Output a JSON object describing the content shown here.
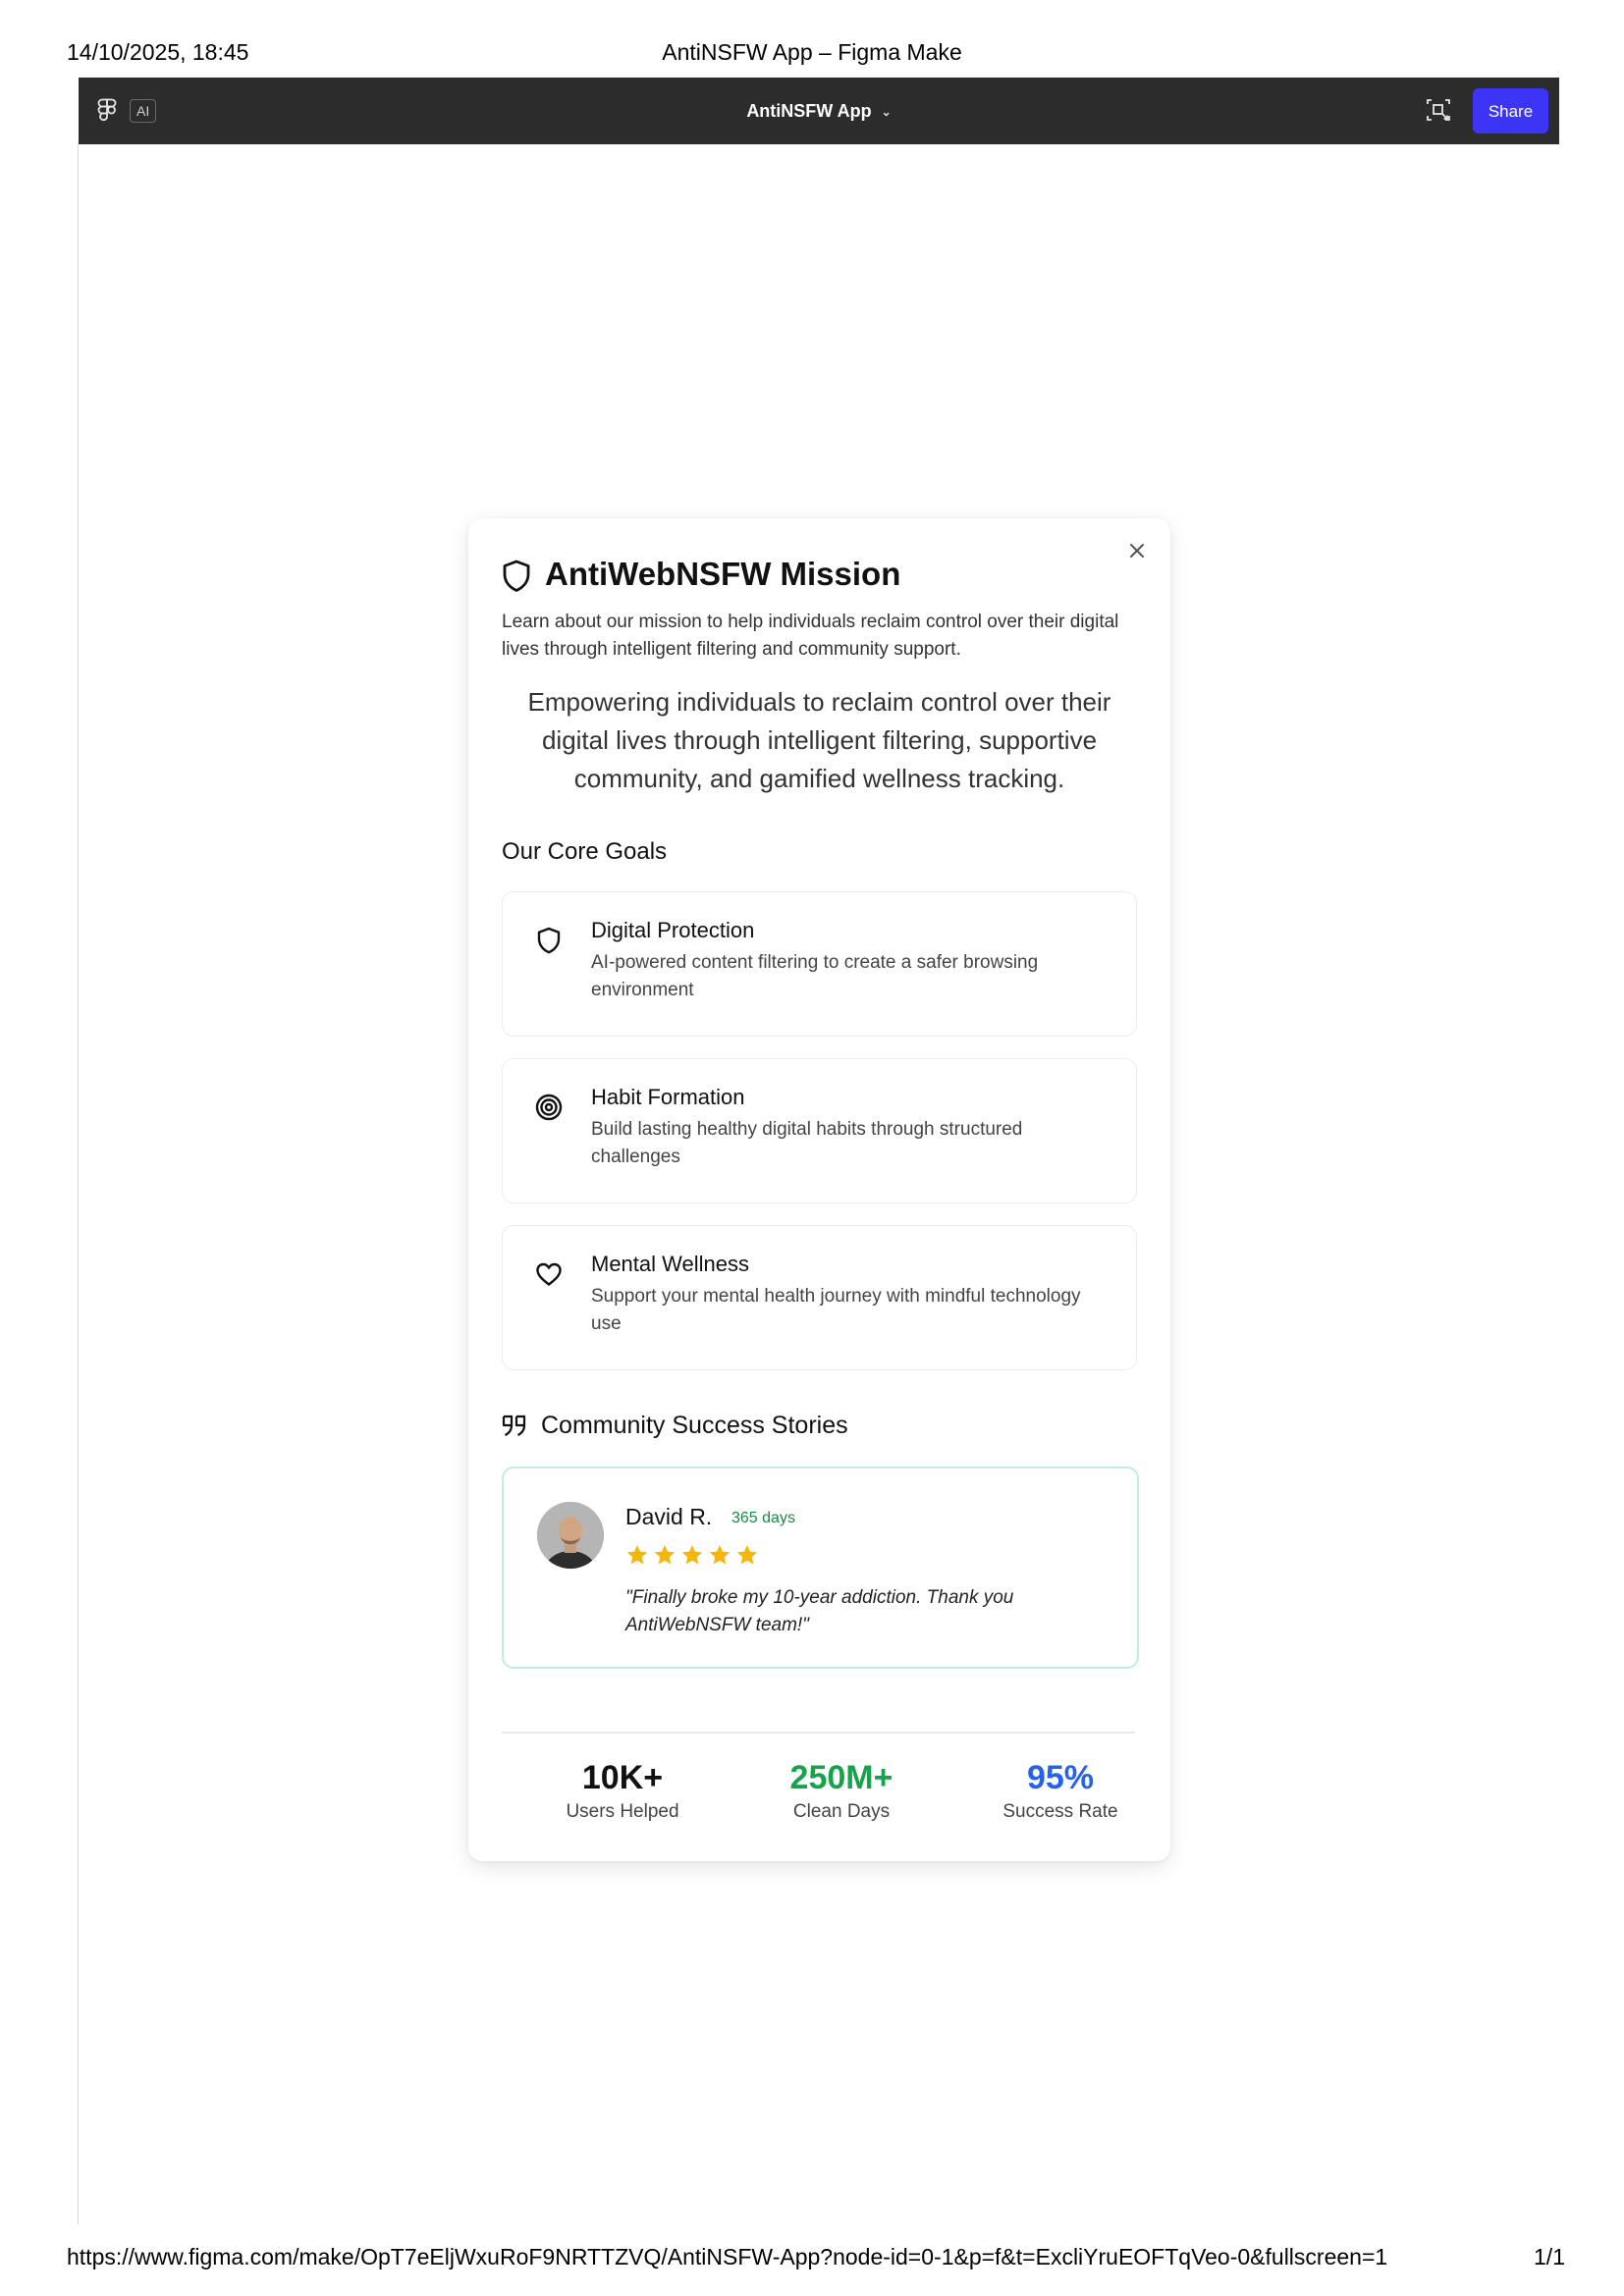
{
  "print": {
    "datetime": "14/10/2025, 18:45",
    "title": "AntiNSFW App – Figma Make",
    "url": "https://www.figma.com/make/OpT7eEljWxuRoF9NRTTZVQ/AntiNSFW-App?node-id=0-1&p=f&t=ExcliYruEOFTqVeo-0&fullscreen=1",
    "page": "1/1"
  },
  "topbar": {
    "ai_badge": "AI",
    "app_title": "AntiNSFW App",
    "share_label": "Share",
    "colors": {
      "bar": "#2c2c2c",
      "share": "#3d35f5"
    }
  },
  "modal": {
    "title": "AntiWebNSFW Mission",
    "description": "Learn about our mission to help individuals reclaim control over their digital lives through intelligent filtering and community support.",
    "mission": "Empowering individuals to reclaim control over their digital lives through intelligent filtering, supportive community, and gamified wellness tracking.",
    "goals_title": "Our Core Goals",
    "goals": [
      {
        "icon": "shield-icon",
        "title": "Digital Protection",
        "desc": "AI-powered content filtering to create a safer browsing environment"
      },
      {
        "icon": "target-icon",
        "title": "Habit Formation",
        "desc": "Build lasting healthy digital habits through structured challenges"
      },
      {
        "icon": "heart-icon",
        "title": "Mental Wellness",
        "desc": "Support your mental health journey with mindful technology use"
      }
    ],
    "stories_title": "Community Success Stories",
    "story": {
      "name": "David R.",
      "days": "365 days",
      "rating": 5,
      "quote": "\"Finally broke my 10-year addiction. Thank you AntiWebNSFW team!\""
    },
    "stats": [
      {
        "value": "10K+",
        "label": "Users Helped",
        "color": "#111111"
      },
      {
        "value": "250M+",
        "label": "Clean Days",
        "color": "#16a34a"
      },
      {
        "value": "95%",
        "label": "Success Rate",
        "color": "#2563eb"
      }
    ]
  }
}
